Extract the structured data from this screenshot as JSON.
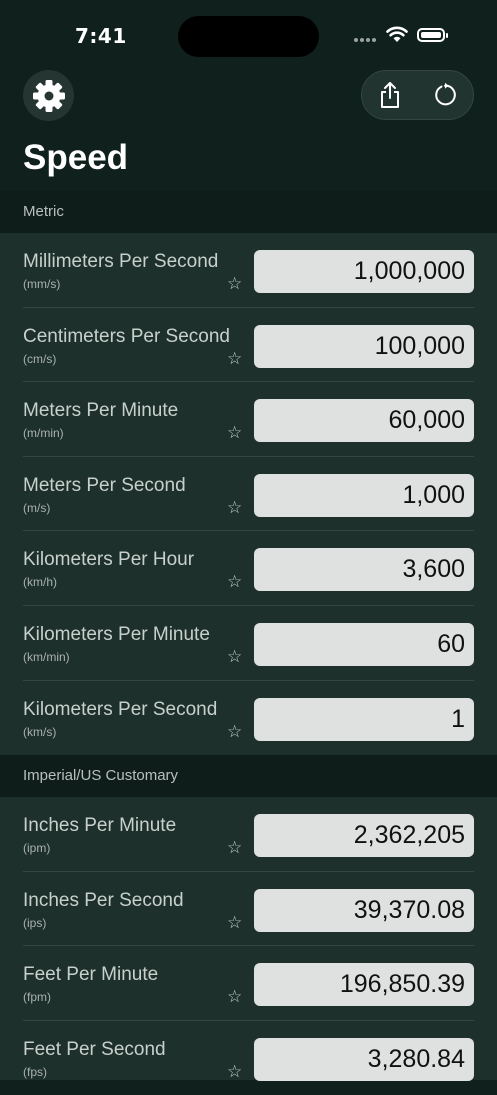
{
  "status": {
    "time": "7:41"
  },
  "header": {
    "title": "Speed"
  },
  "icons": {
    "settings": "gear-icon",
    "share": "share-icon",
    "reset": "reset-icon",
    "favorite": "star-outline-icon"
  },
  "sections": [
    {
      "title": "Metric",
      "rows": [
        {
          "name": "Millimeters Per Second",
          "abbr": "(mm/s)",
          "value": "1,000,000"
        },
        {
          "name": "Centimeters Per Second",
          "abbr": "(cm/s)",
          "value": "100,000"
        },
        {
          "name": "Meters Per Minute",
          "abbr": "(m/min)",
          "value": "60,000"
        },
        {
          "name": "Meters Per Second",
          "abbr": "(m/s)",
          "value": "1,000"
        },
        {
          "name": "Kilometers Per Hour",
          "abbr": "(km/h)",
          "value": "3,600"
        },
        {
          "name": "Kilometers Per Minute",
          "abbr": "(km/min)",
          "value": "60"
        },
        {
          "name": "Kilometers Per Second",
          "abbr": "(km/s)",
          "value": "1"
        }
      ]
    },
    {
      "title": "Imperial/US Customary",
      "rows": [
        {
          "name": "Inches Per Minute",
          "abbr": "(ipm)",
          "value": "2,362,205"
        },
        {
          "name": "Inches Per Second",
          "abbr": "(ips)",
          "value": "39,370.08"
        },
        {
          "name": "Feet Per Minute",
          "abbr": "(fpm)",
          "value": "196,850.39"
        },
        {
          "name": "Feet Per Second",
          "abbr": "(fps)",
          "value": "3,280.84"
        }
      ]
    }
  ],
  "colors": {
    "background": "#10201c",
    "list_background": "#1d302b",
    "section_header": "#0f1d1a",
    "value_field": "#dfe1e0"
  }
}
